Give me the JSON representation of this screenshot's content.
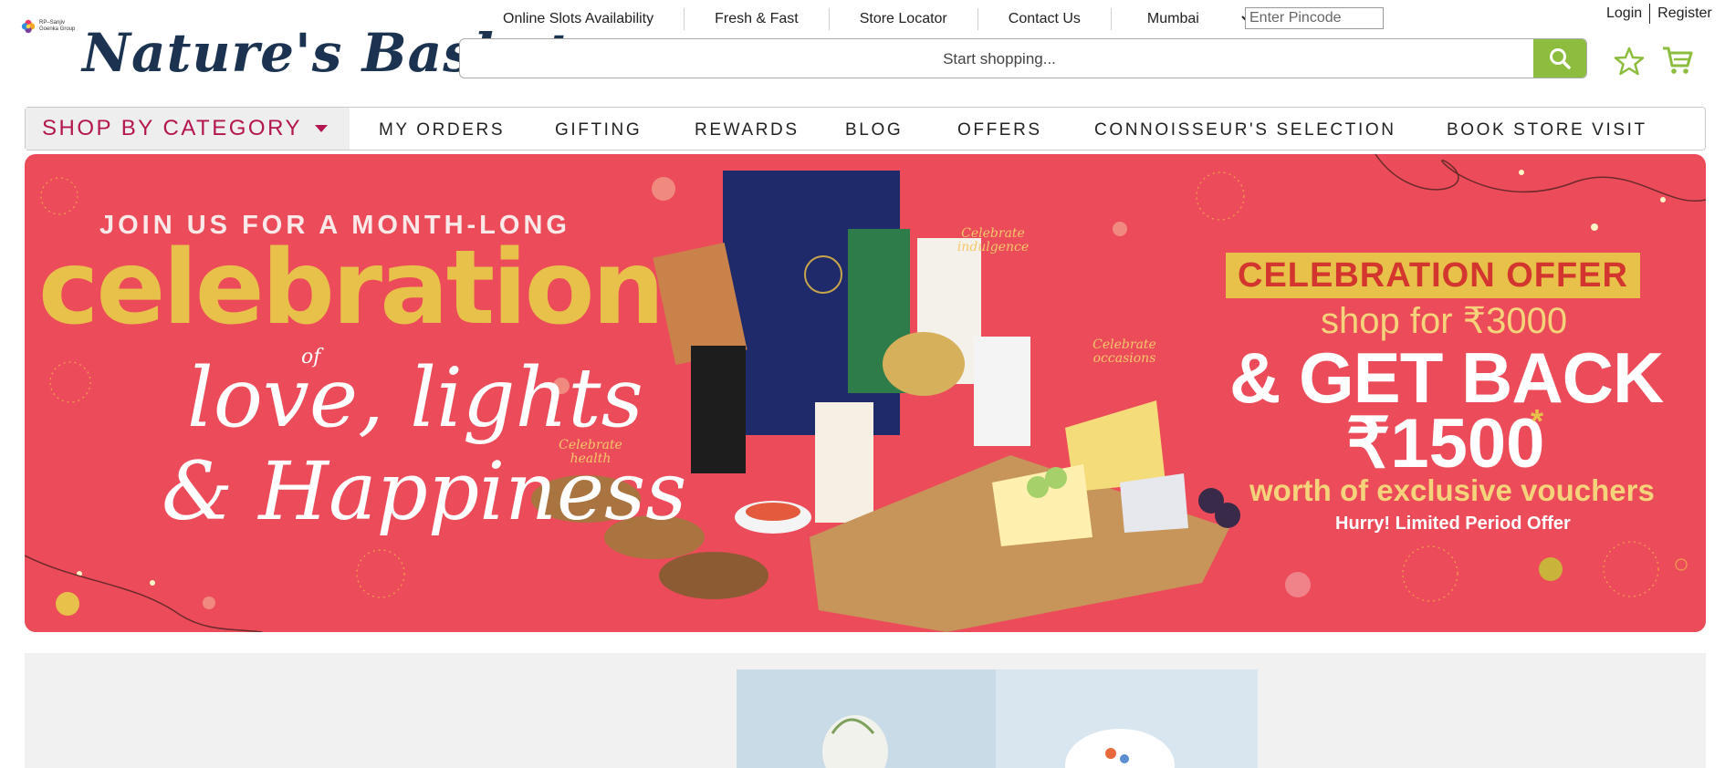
{
  "brand": {
    "name": "Nature's Basket",
    "group_text": "RP–Sanjiv Goenka Group"
  },
  "top_links": [
    {
      "label": "Online Slots Availability"
    },
    {
      "label": "Fresh & Fast"
    },
    {
      "label": "Store Locator"
    },
    {
      "label": "Contact Us"
    }
  ],
  "city": {
    "selected": "Mumbai"
  },
  "pincode": {
    "placeholder": "Enter Pincode"
  },
  "auth": {
    "login": "Login",
    "register": "Register"
  },
  "search": {
    "placeholder": "Start shopping...",
    "button_icon": "search-icon"
  },
  "icons": {
    "wishlist": "star-icon",
    "cart": "cart-icon"
  },
  "colors": {
    "brand_green": "#8cbd3f",
    "brand_navy": "#1b3350",
    "category_pink": "#b3154e",
    "banner_red": "#ec4b5a",
    "gold": "#e8c14a"
  },
  "nav": {
    "shop_by_category": "SHOP BY CATEGORY",
    "items": [
      "MY ORDERS",
      "GIFTING",
      "REWARDS",
      "BLOG",
      "OFFERS",
      "CONNOISSEUR'S SELECTION",
      "BOOK STORE VISIT"
    ]
  },
  "banner": {
    "line1": "JOIN US FOR A MONTH-LONG",
    "line2": "celebration",
    "line3": "of",
    "line4": "love, lights",
    "line5": "& Happiness",
    "tags": [
      "Celebrate indulgence",
      "Celebrate health",
      "Celebrate occasions"
    ],
    "offer": {
      "title": "CELEBRATION OFFER",
      "shop_for": "shop for ₹3000",
      "get_back": "& GET BACK",
      "amount": "₹1500",
      "asterisk": "*",
      "worth": "worth of exclusive vouchers",
      "hurry": "Hurry! Limited Period Offer"
    }
  }
}
